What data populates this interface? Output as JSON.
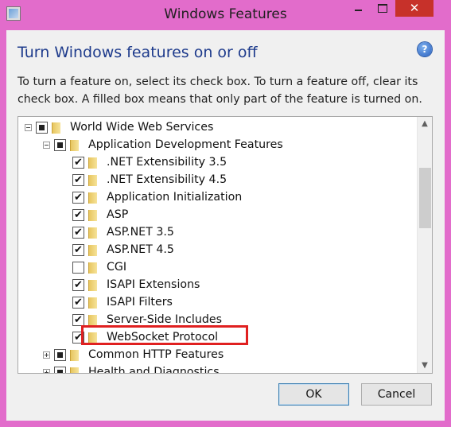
{
  "window": {
    "title": "Windows Features",
    "close_glyph": "✕"
  },
  "heading": "Turn Windows features on or off",
  "help_glyph": "?",
  "description": "To turn a feature on, select its check box. To turn a feature off, clear its check box. A filled box means that only part of the feature is turned on.",
  "tree": {
    "items": [
      {
        "label": "World Wide Web Services",
        "state": "partial",
        "expander": "minus"
      },
      {
        "label": "Application Development Features",
        "state": "partial",
        "expander": "minus"
      },
      {
        "label": ".NET Extensibility 3.5",
        "state": "checked"
      },
      {
        "label": ".NET Extensibility 4.5",
        "state": "checked"
      },
      {
        "label": "Application Initialization",
        "state": "checked"
      },
      {
        "label": "ASP",
        "state": "checked"
      },
      {
        "label": "ASP.NET 3.5",
        "state": "checked"
      },
      {
        "label": "ASP.NET 4.5",
        "state": "checked"
      },
      {
        "label": "CGI",
        "state": "unchecked"
      },
      {
        "label": "ISAPI Extensions",
        "state": "checked"
      },
      {
        "label": "ISAPI Filters",
        "state": "checked"
      },
      {
        "label": "Server-Side Includes",
        "state": "checked"
      },
      {
        "label": "WebSocket Protocol",
        "state": "checked",
        "highlighted": true
      },
      {
        "label": "Common HTTP Features",
        "state": "partial",
        "expander": "plus"
      },
      {
        "label": "Health and Diagnostics",
        "state": "partial",
        "expander": "plus"
      }
    ],
    "check_glyph": "✔"
  },
  "scrollbar": {
    "up_glyph": "▲",
    "down_glyph": "▼"
  },
  "buttons": {
    "ok": "OK",
    "cancel": "Cancel"
  },
  "colors": {
    "highlight": "#e02020",
    "window_frame": "#e26ccb",
    "heading": "#1e3b8c"
  }
}
